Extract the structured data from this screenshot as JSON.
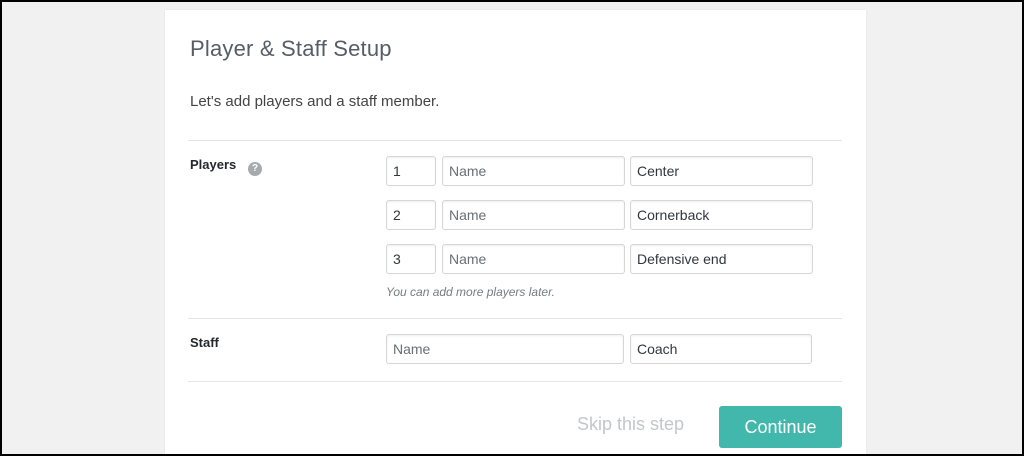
{
  "page": {
    "title": "Player & Staff Setup",
    "intro": "Let's add players and a staff member."
  },
  "players": {
    "label": "Players",
    "help_icon": "?",
    "hint": "You can add more players later.",
    "rows": [
      {
        "number": "1",
        "name_placeholder": "Name",
        "position": "Center"
      },
      {
        "number": "2",
        "name_placeholder": "Name",
        "position": "Cornerback"
      },
      {
        "number": "3",
        "name_placeholder": "Name",
        "position": "Defensive end"
      }
    ]
  },
  "staff": {
    "label": "Staff",
    "name_placeholder": "Name",
    "role": "Coach"
  },
  "footer": {
    "skip_label": "Skip this step",
    "continue_label": "Continue"
  },
  "colors": {
    "accent": "#42b8ad",
    "background": "#f1f1f1",
    "muted_link": "#c3c7ca"
  },
  "icons": {
    "help": "question-mark-circle"
  }
}
